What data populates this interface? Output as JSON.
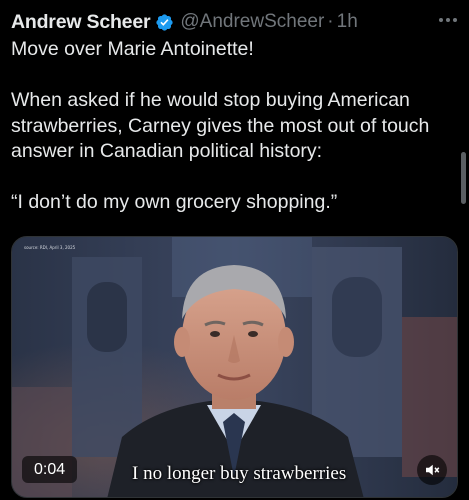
{
  "tweet": {
    "author": {
      "display_name": "Andrew Scheer",
      "handle": "@AndrewScheer",
      "verified": true,
      "verified_color": "#1d9bf0"
    },
    "separator": "·",
    "time": "1h",
    "text": {
      "line1": "Move over Marie Antoinette!",
      "paragraph2": "When asked if he would stop buying American strawberries,  Carney gives the most out of touch answer in Canadian political history:",
      "paragraph3": "“I don’t do my own grocery shopping.”"
    },
    "media": {
      "type": "video",
      "source_caption": "source: RDI, April 3, 2025",
      "subtitle": "I no longer buy strawberries",
      "timestamp": "0:04",
      "muted": true
    },
    "icons": {
      "verified": "verified-badge-icon",
      "more": "more-horizontal-icon",
      "mute": "volume-muted-icon"
    }
  },
  "colors": {
    "background": "#000000",
    "text_primary": "#e7e9ea",
    "text_secondary": "#71767b"
  }
}
